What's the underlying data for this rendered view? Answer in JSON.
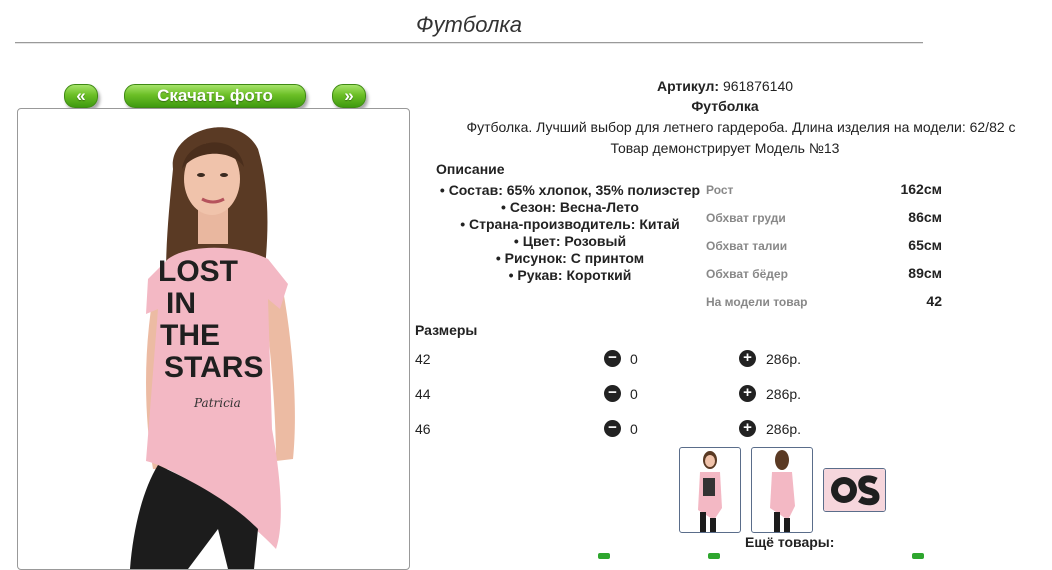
{
  "page": {
    "title": "Футболка"
  },
  "gallery": {
    "prev_label": "«",
    "download_label": "Скачать фото",
    "next_label": "»",
    "print_text": "LOST IN THE STARS",
    "brand_text": "Patricia"
  },
  "product": {
    "article_label": "Артикул:",
    "article_value": "961876140",
    "name": "Футболка",
    "description": "Футболка. Лучший выбор для летнего гардероба. Длина изделия на модели: 62/82 с",
    "model_note": "Товар демонстрирует Модель №13"
  },
  "description": {
    "heading": "Описание",
    "items": [
      "Состав: 65% хлопок, 35% полиэстер",
      "Сезон: Весна-Лето",
      "Страна-производитель: Китай",
      "Цвет: Розовый",
      "Рисунок: С принтом",
      "Рукав: Короткий"
    ]
  },
  "measurements": [
    {
      "label": "Рост",
      "value": "162см"
    },
    {
      "label": "Обхват груди",
      "value": "86см"
    },
    {
      "label": "Обхват талии",
      "value": "65см"
    },
    {
      "label": "Обхват бёдер",
      "value": "89см"
    },
    {
      "label": "На модели товар",
      "value": "42"
    }
  ],
  "sizes": {
    "heading": "Размеры",
    "rows": [
      {
        "size": "42",
        "qty": "0",
        "price": "286р."
      },
      {
        "size": "44",
        "qty": "0",
        "price": "286р."
      },
      {
        "size": "46",
        "qty": "0",
        "price": "286р."
      }
    ],
    "minus_icon": "minus-circle-icon",
    "plus_icon": "plus-circle-icon"
  },
  "thumbnails": [
    "front-view",
    "back-view",
    "print-detail"
  ],
  "more": {
    "heading": "Ещё товары:"
  },
  "colors": {
    "button_green": "#6cbf26",
    "shirt_pink": "#f3b8c4",
    "leggings": "#1c1c1c",
    "link_green": "#2ea62e"
  }
}
